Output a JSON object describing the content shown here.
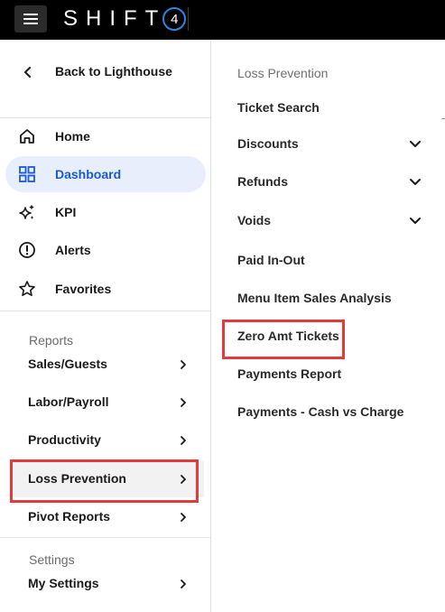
{
  "topbar": {
    "logo_text": "SHIFT",
    "logo_number": "4",
    "menu_icon": "hamburger-icon",
    "accent_color": "#2a86e0"
  },
  "sidebar": {
    "back_label": "Back to Lighthouse",
    "nav_items": [
      {
        "label": "Home",
        "icon": "home-icon",
        "active": false
      },
      {
        "label": "Dashboard",
        "icon": "dashboard-grid-icon",
        "active": true
      },
      {
        "label": "KPI",
        "icon": "sparkles-icon",
        "active": false
      },
      {
        "label": "Alerts",
        "icon": "alert-circle-icon",
        "active": false
      },
      {
        "label": "Favorites",
        "icon": "star-icon",
        "active": false
      }
    ],
    "reports_section": "Reports",
    "reports": [
      {
        "label": "Sales/Guests"
      },
      {
        "label": "Labor/Payroll"
      },
      {
        "label": "Productivity"
      },
      {
        "label": "Loss Prevention",
        "highlighted": true
      },
      {
        "label": "Pivot Reports"
      }
    ],
    "settings_section": "Settings",
    "settings": [
      {
        "label": "My Settings"
      }
    ],
    "active_color": "#1a5bd1",
    "highlight_color": "#e23b3b"
  },
  "panel": {
    "header": "Loss Prevention",
    "items": [
      {
        "label": "Ticket Search",
        "expandable": false
      },
      {
        "label": "Discounts",
        "expandable": true
      },
      {
        "label": "Refunds",
        "expandable": true
      },
      {
        "label": "Voids",
        "expandable": true
      },
      {
        "label": "Paid In-Out",
        "expandable": false
      },
      {
        "label": "Menu Item Sales Analysis",
        "expandable": false
      },
      {
        "label": "Zero Amt Tickets",
        "expandable": false,
        "highlighted": true
      },
      {
        "label": "Payments Report",
        "expandable": false
      },
      {
        "label": "Payments - Cash vs Charge",
        "expandable": false
      }
    ]
  }
}
